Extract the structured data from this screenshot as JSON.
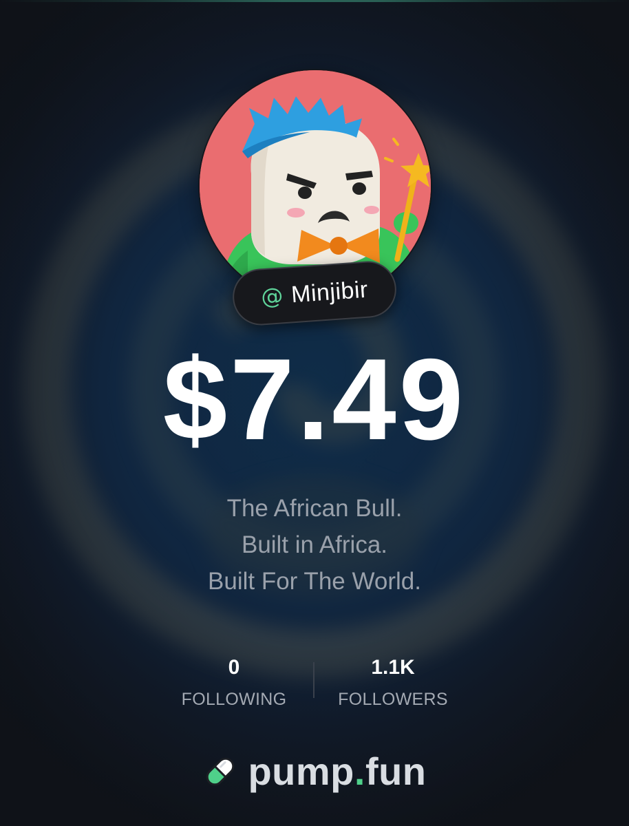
{
  "profile": {
    "handle_prefix": "@",
    "handle": "Minjibir",
    "avatar_icon": "angry-mascot-avatar"
  },
  "price": {
    "value": "$7.49"
  },
  "bio": {
    "lines": [
      "The African Bull.",
      "Built in Africa.",
      "Built For The World."
    ]
  },
  "stats": {
    "following": {
      "value": "0",
      "label": "FOLLOWING"
    },
    "followers": {
      "value": "1.1K",
      "label": "FOLLOWERS"
    }
  },
  "brand": {
    "name_part1": "pump",
    "dot": ".",
    "name_part2": "fun",
    "icon": "pill-icon"
  },
  "colors": {
    "accent_green": "#4fd08a",
    "avatar_background": "#ea6d70",
    "page_background": "#141a24"
  }
}
